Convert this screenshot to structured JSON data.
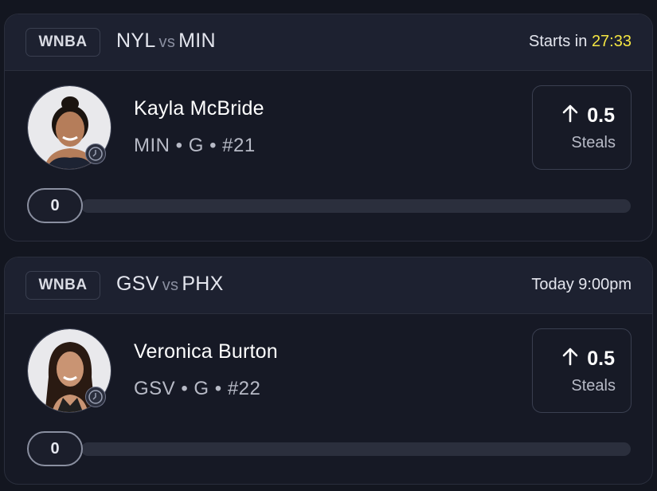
{
  "cards": [
    {
      "league": "WNBA",
      "home": "NYL",
      "vs": "vs",
      "away": "MIN",
      "start_prefix": "Starts in",
      "start_value": "27:33",
      "player_name": "Kayla McBride",
      "player_meta": "MIN • G • #21",
      "line_value": "0.5",
      "line_direction": "up-arrow-icon",
      "stat_label": "Steals",
      "progress_value": "0",
      "progress_fraction": 0
    },
    {
      "league": "WNBA",
      "home": "GSV",
      "vs": "vs",
      "away": "PHX",
      "start_prefix": "Today 9:00pm",
      "start_value": "",
      "player_name": "Veronica Burton",
      "player_meta": "GSV • G • #22",
      "line_value": "0.5",
      "line_direction": "up-arrow-icon",
      "stat_label": "Steals",
      "progress_value": "0",
      "progress_fraction": 0
    }
  ],
  "colors": {
    "background": "#131620",
    "card": "#161925",
    "header": "#1d2130",
    "countdown": "#f4e542",
    "muted_text": "#b7bac6"
  }
}
